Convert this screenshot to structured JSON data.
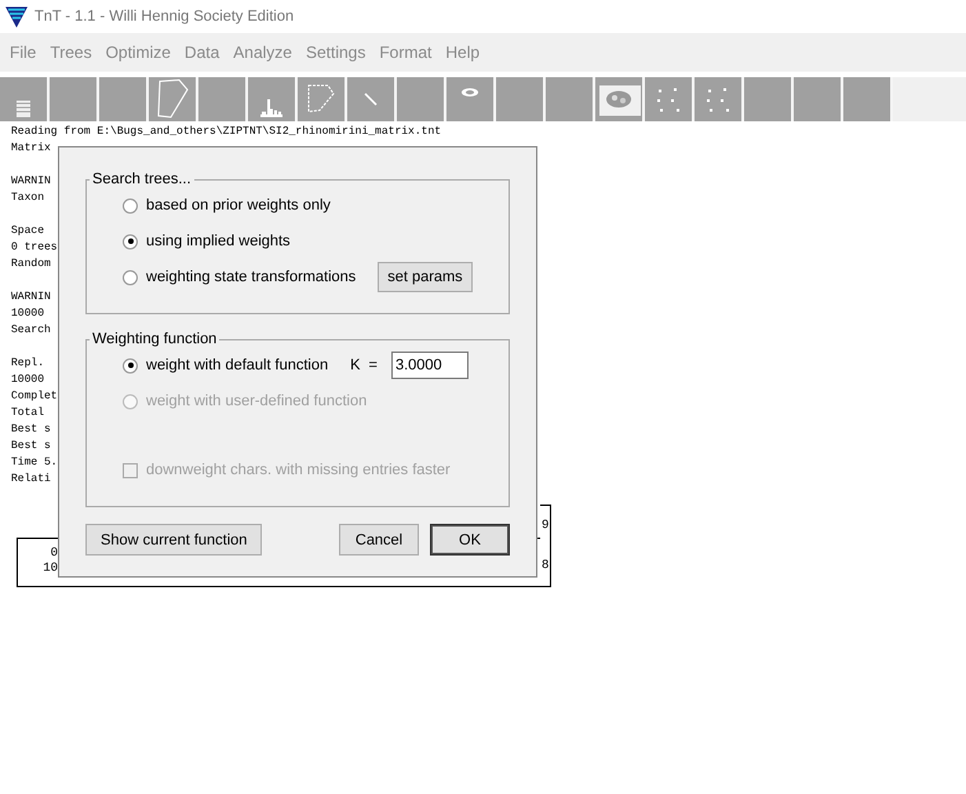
{
  "window": {
    "title": "TnT - 1.1 - Willi Hennig Society Edition"
  },
  "menu": [
    "File",
    "Trees",
    "Optimize",
    "Data",
    "Analyze",
    "Settings",
    "Format",
    "Help"
  ],
  "toolbar": [
    {
      "kind": "grid",
      "pressed": false
    },
    {
      "kind": "none",
      "pressed": false
    },
    {
      "kind": "none",
      "pressed": false
    },
    {
      "kind": "blob",
      "pressed": false
    },
    {
      "kind": "none",
      "pressed": false
    },
    {
      "kind": "histogram",
      "pressed": false
    },
    {
      "kind": "dashed-blob",
      "pressed": false
    },
    {
      "kind": "line",
      "pressed": false
    },
    {
      "kind": "none",
      "pressed": false
    },
    {
      "kind": "eye",
      "pressed": false
    },
    {
      "kind": "none",
      "pressed": false
    },
    {
      "kind": "none",
      "pressed": false
    },
    {
      "kind": "cloud",
      "pressed": true
    },
    {
      "kind": "dots",
      "pressed": false
    },
    {
      "kind": "dots",
      "pressed": false
    },
    {
      "kind": "none",
      "pressed": false
    },
    {
      "kind": "none",
      "pressed": false
    },
    {
      "kind": "none",
      "pressed": false
    }
  ],
  "console": {
    "blocks": [
      [
        "Reading from E:\\Bugs_and_others\\ZIPTNT\\SI2_rhinomirini_matrix.tnt",
        "Matrix"
      ],
      [
        "WARNIN",
        "Taxon"
      ],
      [
        "Space",
        "0 trees",
        "Random"
      ],
      [
        "WARNIN",
        "10000",
        "Search"
      ],
      [
        "Repl.",
        "10000",
        "Complet",
        "Total",
        "Best s",
        "Best s",
        "Time 5.",
        "Relati"
      ]
    ],
    "table": {
      "left_cells": [
        "0",
        "10"
      ],
      "right_cells": [
        "9",
        "8"
      ]
    }
  },
  "dialog": {
    "groups": [
      {
        "title": "Search trees...",
        "rows": [
          {
            "kind": "radio",
            "label": "based on prior weights only",
            "selected": false,
            "disabled": false
          },
          {
            "kind": "radio",
            "label": "using implied weights",
            "selected": true,
            "disabled": false
          },
          {
            "kind": "radio",
            "label": "weighting state transformations",
            "selected": false,
            "disabled": false,
            "button": "set params"
          }
        ]
      },
      {
        "title": "Weighting function",
        "rows": [
          {
            "kind": "radio",
            "label": "weight with default function",
            "selected": true,
            "disabled": false,
            "field_label": "K  =",
            "field_value": "3.0000"
          },
          {
            "kind": "radio",
            "label": "weight with user-defined function",
            "selected": false,
            "disabled": true
          },
          {
            "kind": "checkbox",
            "label": "downweight chars. with missing entries faster",
            "checked": false,
            "disabled": true
          }
        ]
      }
    ],
    "buttons": [
      {
        "label": "Show current function",
        "default": false
      },
      {
        "label": "Cancel",
        "default": false
      },
      {
        "label": "OK",
        "default": true
      }
    ]
  }
}
